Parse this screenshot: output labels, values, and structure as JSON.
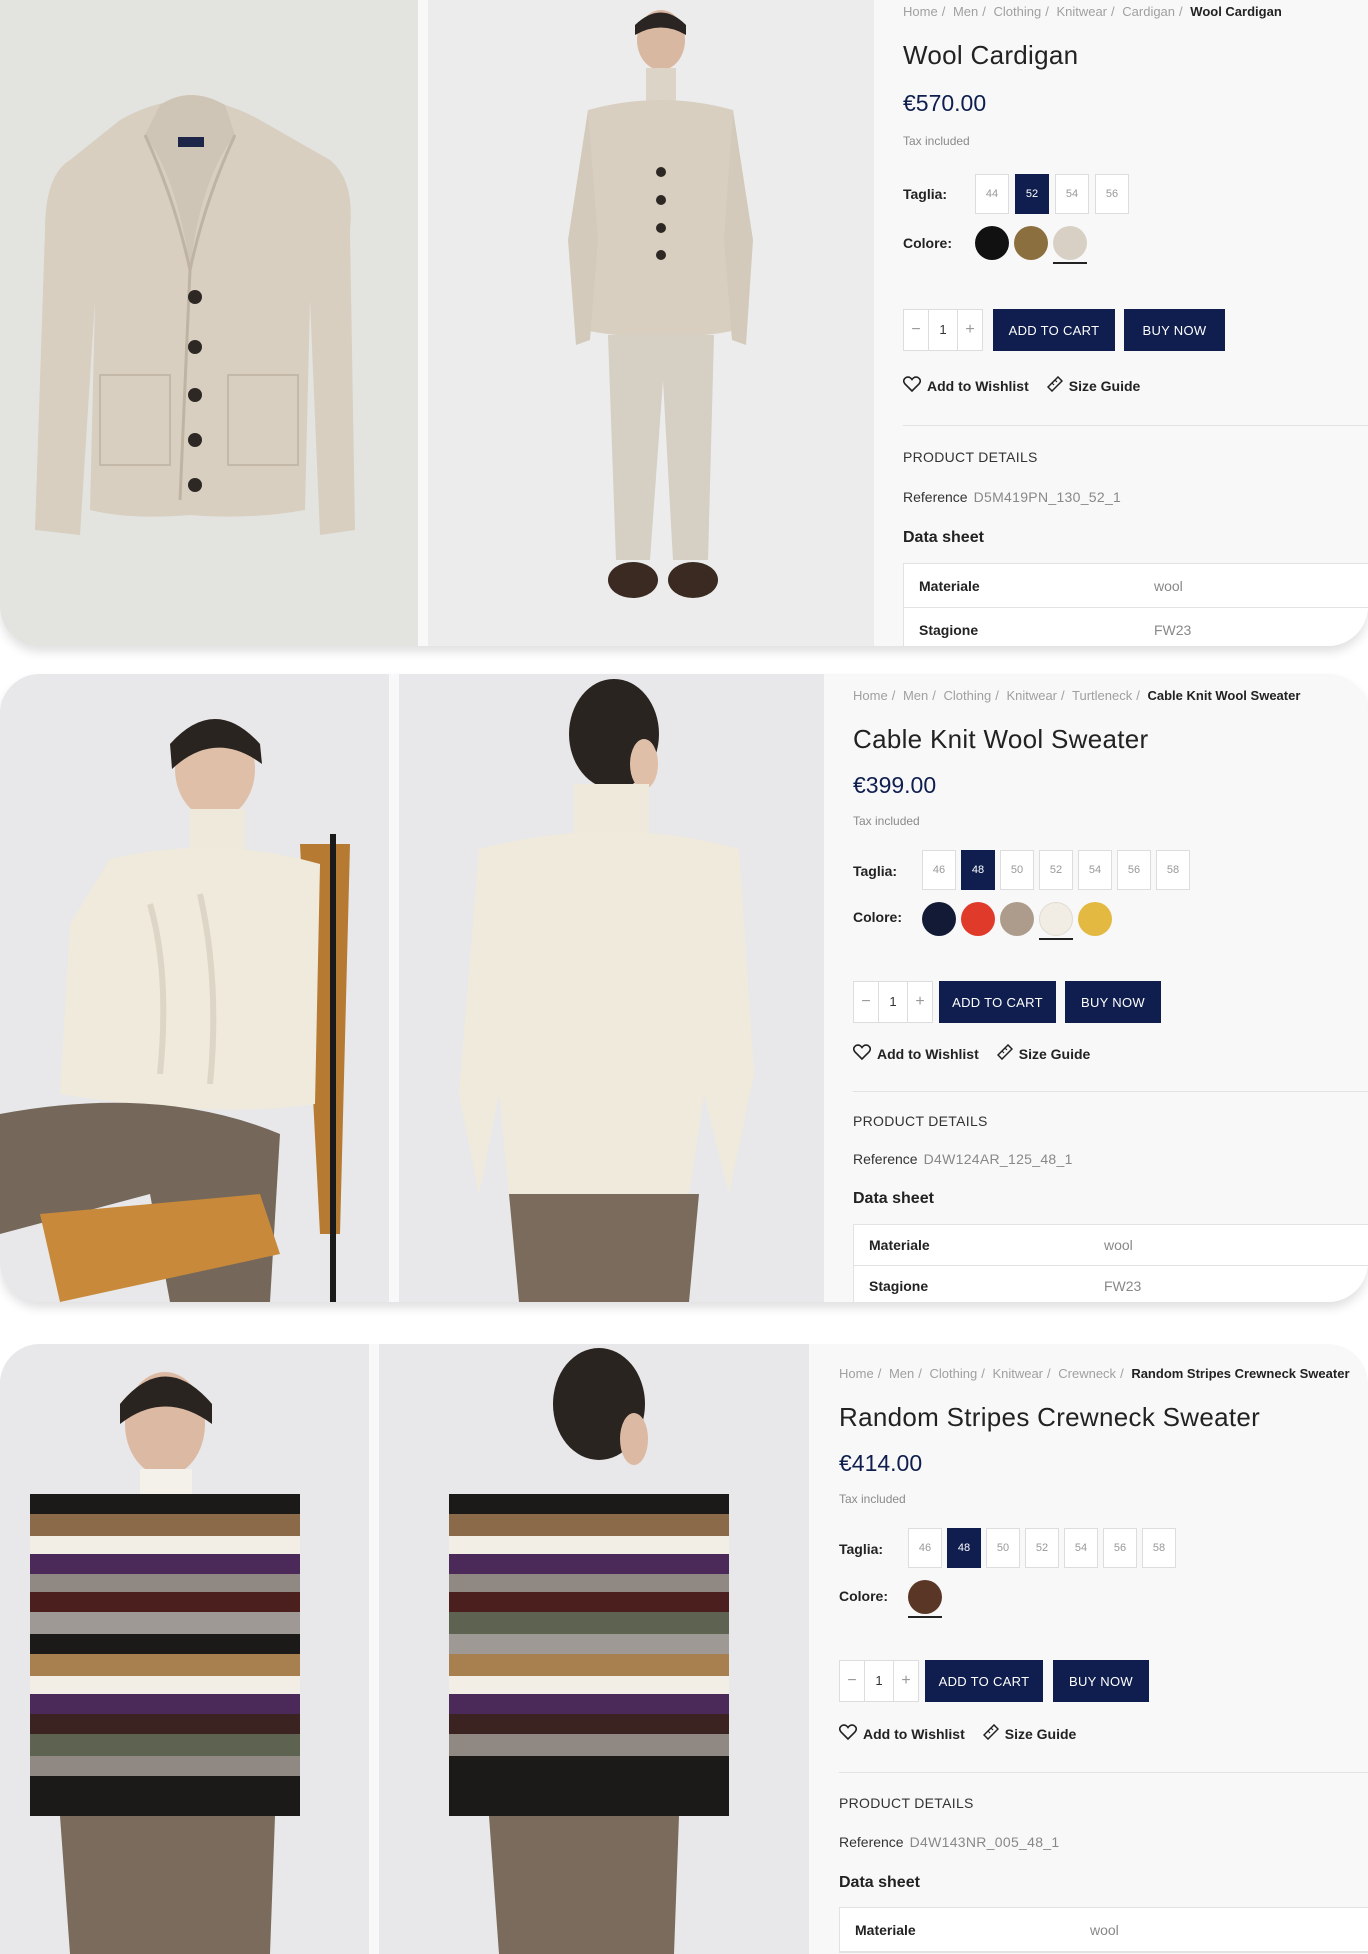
{
  "colors": {
    "navy": "#0f1e4e",
    "border": "#dddddd",
    "muted": "#8a8a8a"
  },
  "products": [
    {
      "breadcrumb": [
        "Home",
        "Men",
        "Clothing",
        "Knitwear",
        "Cardigan"
      ],
      "breadcrumb_current": "Wool Cardigan",
      "title": "Wool Cardigan",
      "price": "€570.00",
      "tax_note": "Tax included",
      "size_label": "Taglia:",
      "sizes": [
        "44",
        "52",
        "54",
        "56"
      ],
      "selected_size": "52",
      "color_label": "Colore:",
      "color_swatches": [
        "#111111",
        "#8b6f3e",
        "#d8d0c4"
      ],
      "selected_color_index": 2,
      "quantity": "1",
      "add_to_cart": "ADD TO CART",
      "buy_now": "BUY NOW",
      "wishlist": "Add to Wishlist",
      "size_guide": "Size Guide",
      "details_heading": "PRODUCT DETAILS",
      "reference_label": "Reference",
      "reference_value": "D5M419PN_130_52_1",
      "data_sheet_heading": "Data sheet",
      "data_sheet": [
        {
          "key": "Materiale",
          "value": "wool"
        },
        {
          "key": "Stagione",
          "value": "FW23"
        }
      ],
      "images": [
        "flat-lay-cardigan-photo",
        "model-front-cardigan-photo"
      ]
    },
    {
      "breadcrumb": [
        "Home",
        "Men",
        "Clothing",
        "Knitwear",
        "Turtleneck"
      ],
      "breadcrumb_current": "Cable Knit Wool Sweater",
      "title": "Cable Knit Wool Sweater",
      "price": "€399.00",
      "tax_note": "Tax included",
      "size_label": "Taglia:",
      "sizes": [
        "46",
        "48",
        "50",
        "52",
        "54",
        "56",
        "58"
      ],
      "selected_size": "48",
      "color_label": "Colore:",
      "color_swatches": [
        "#121a36",
        "#e03a2a",
        "#ad9c8c",
        "#f2ede4",
        "#e3b941"
      ],
      "selected_color_index": 3,
      "quantity": "1",
      "add_to_cart": "ADD TO CART",
      "buy_now": "BUY NOW",
      "wishlist": "Add to Wishlist",
      "size_guide": "Size Guide",
      "details_heading": "PRODUCT DETAILS",
      "reference_label": "Reference",
      "reference_value": "D4W124AR_125_48_1",
      "data_sheet_heading": "Data sheet",
      "data_sheet": [
        {
          "key": "Materiale",
          "value": "wool"
        },
        {
          "key": "Stagione",
          "value": "FW23"
        }
      ],
      "images": [
        "model-seated-sweater-photo",
        "model-back-sweater-photo"
      ]
    },
    {
      "breadcrumb": [
        "Home",
        "Men",
        "Clothing",
        "Knitwear",
        "Crewneck"
      ],
      "breadcrumb_current": "Random Stripes Crewneck Sweater",
      "title": "Random Stripes Crewneck Sweater",
      "price": "€414.00",
      "tax_note": "Tax included",
      "size_label": "Taglia:",
      "sizes": [
        "46",
        "48",
        "50",
        "52",
        "54",
        "56",
        "58"
      ],
      "selected_size": "48",
      "color_label": "Colore:",
      "color_swatches": [
        "#5a3626"
      ],
      "selected_color_index": 0,
      "quantity": "1",
      "add_to_cart": "ADD TO CART",
      "buy_now": "BUY NOW",
      "wishlist": "Add to Wishlist",
      "size_guide": "Size Guide",
      "details_heading": "PRODUCT DETAILS",
      "reference_label": "Reference",
      "reference_value": "D4W143NR_005_48_1",
      "data_sheet_heading": "Data sheet",
      "data_sheet": [
        {
          "key": "Materiale",
          "value": "wool"
        }
      ],
      "images": [
        "model-front-stripes-photo",
        "model-back-stripes-photo"
      ]
    }
  ]
}
